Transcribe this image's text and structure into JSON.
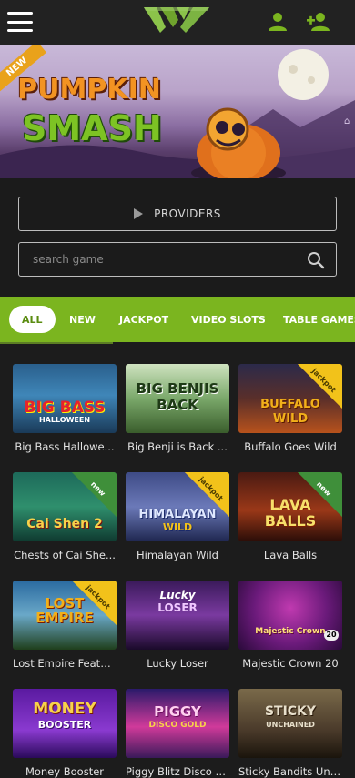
{
  "header": {
    "menu_icon": "hamburger-icon",
    "logo": "brand-logo",
    "login_icon": "user-icon",
    "register_icon": "add-user-icon"
  },
  "banner": {
    "badge": "NEW",
    "title_line1": "PUMPKIN",
    "title_line2": "SMASH"
  },
  "providers": {
    "label": "PROVIDERS"
  },
  "search": {
    "placeholder": "search game"
  },
  "categories": [
    "ALL",
    "NEW",
    "JACKPOT",
    "VIDEO SLOTS",
    "TABLE GAMES"
  ],
  "games": [
    {
      "name": "Big Bass Hallowe...",
      "art": "BIG BASS",
      "sub": "HALLOWEEN",
      "badge": ""
    },
    {
      "name": "Big Benji is Back ...",
      "art": "BIG BENJIS",
      "sub": "BACK",
      "badge": ""
    },
    {
      "name": "Buffalo Goes Wild",
      "art": "BUFFALO",
      "sub": "WILD",
      "badge": "jackpot"
    },
    {
      "name": "Chests of Cai She...",
      "art": "Cai Shen 2",
      "sub": "",
      "badge": "new"
    },
    {
      "name": "Himalayan Wild",
      "art": "HIMALAYAN",
      "sub": "WILD",
      "badge": "jackpot"
    },
    {
      "name": "Lava Balls",
      "art": "LAVA",
      "sub": "BALLS",
      "badge": "new"
    },
    {
      "name": "Lost Empire Featu...",
      "art": "LOST",
      "sub": "EMPIRE",
      "badge": "jackpot"
    },
    {
      "name": "Lucky Loser",
      "art": "Lucky",
      "sub": "LOSER",
      "badge": ""
    },
    {
      "name": "Majestic Crown 20",
      "art": "Majestic Crown",
      "sub": "20",
      "badge": ""
    },
    {
      "name": "Money Booster",
      "art": "MONEY",
      "sub": "BOOSTER",
      "badge": ""
    },
    {
      "name": "Piggy Blitz Disco Gold",
      "art": "PIGGY",
      "sub": "DISCO GOLD",
      "badge": ""
    },
    {
      "name": "Sticky Bandits Unchained",
      "art": "STICKY",
      "sub": "UNCHAINED",
      "badge": ""
    }
  ],
  "colors": {
    "accent": "#7bb51f",
    "jackpot": "#f2c21a",
    "new": "#3f8f3a"
  }
}
